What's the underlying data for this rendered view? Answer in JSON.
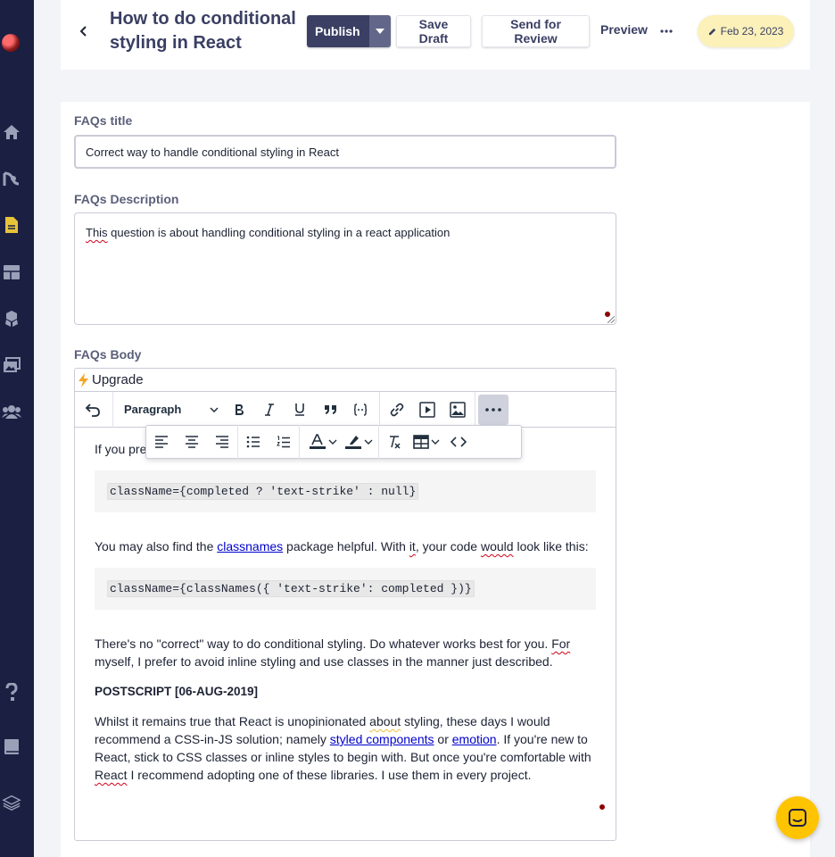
{
  "header": {
    "title": "How to do conditional styling in React",
    "publish_label": "Publish",
    "save_draft_label": "Save Draft",
    "send_review_label": "Send for Review",
    "preview_label": "Preview",
    "date": "Feb 23, 2023"
  },
  "form": {
    "title_label": "FAQs title",
    "title_value": "Correct way to handle conditional styling in React",
    "description_label": "FAQs Description",
    "description_first_word": "This",
    "description_rest": " question is about handling conditional styling in a react application",
    "body_label": "FAQs Body"
  },
  "editor": {
    "upgrade_label": "Upgrade",
    "format_select": "Paragraph",
    "content": {
      "p1_visible": "If you pre",
      "code1": "className={completed ? 'text-strike' : null}",
      "p2_a": "You may also find the ",
      "p2_link": "classnames",
      "p2_b": " package helpful. With ",
      "p2_it": "it",
      "p2_c": ", your code ",
      "p2_would": "would",
      "p2_d": " look like this:",
      "code2": "className={classNames({ 'text-strike': completed })}",
      "p3_a": "There's no \"correct\" way to do conditional styling. Do whatever works best for you. ",
      "p3_for": "For",
      "p3_b": " myself, I prefer to avoid inline styling and use classes in the manner just described.",
      "postscript": "POSTSCRIPT [06-AUG-2019]",
      "p4_a": "Whilst it remains true that React is unopinionated ",
      "p4_about": "about",
      "p4_b": " styling, these days I would recommend a CSS-in-JS solution; namely ",
      "p4_link1": "styled components",
      "p4_c": " or ",
      "p4_link2": "emotion",
      "p4_d": ". If you're new to React, stick to CSS classes or inline styles to begin with. But once you're comfortable with ",
      "p4_react": "React",
      "p4_e": " I recommend adopting one of these libraries. I use them in every project."
    }
  },
  "icons": {
    "sidebar": [
      "avatar",
      "home-icon",
      "analytics-icon",
      "document-icon",
      "layout-icon",
      "components-icon",
      "media-icon",
      "users-icon",
      "help-icon",
      "book-icon",
      "layers-icon"
    ],
    "chat": "chat-icon"
  },
  "colors": {
    "sidebar_bg": "#1b1f42",
    "primary": "#3a3f63",
    "accent_yellow": "#ffc400",
    "document_icon": "#e8c33a",
    "date_badge": "#fbf1b9"
  }
}
